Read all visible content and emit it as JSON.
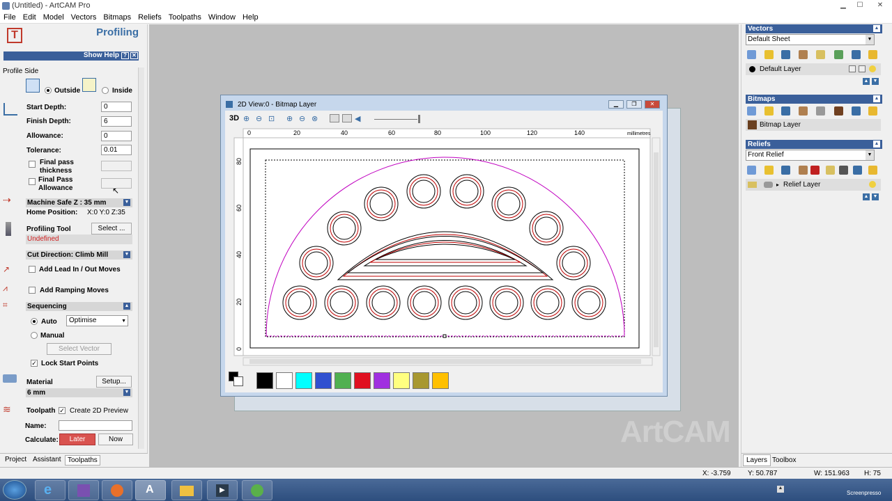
{
  "window": {
    "title": "(Untitled) - ArtCAM Pro"
  },
  "menu": [
    "File",
    "Edit",
    "Model",
    "Vectors",
    "Bitmaps",
    "Reliefs",
    "Toolpaths",
    "Window",
    "Help"
  ],
  "left_panel": {
    "title": "Profiling",
    "show_help": "Show Help",
    "help_q": "?",
    "profile_side": "Profile Side",
    "outside": "Outside",
    "inside": "Inside",
    "start_depth_label": "Start Depth:",
    "start_depth": "0",
    "finish_depth_label": "Finish Depth:",
    "finish_depth": "6",
    "allowance_label": "Allowance:",
    "allowance": "0",
    "tolerance_label": "Tolerance:",
    "tolerance": "0.01",
    "final_pass_thickness": "Final pass thickness",
    "final_pass_allowance": "Final Pass Allowance",
    "machine_safe_z": "Machine Safe Z : 35 mm",
    "home_position_label": "Home Position:",
    "home_position": "X:0 Y:0 Z:35",
    "profiling_tool": "Profiling Tool",
    "select_btn": "Select ...",
    "undefined": "Undefined",
    "cut_direction": "Cut Direction: Climb Mill",
    "add_lead": "Add Lead In / Out Moves",
    "add_ramping": "Add Ramping Moves",
    "sequencing": "Sequencing",
    "auto": "Auto",
    "optimise": "Optimise",
    "manual": "Manual",
    "select_vector": "Select Vector",
    "lock_start_points": "Lock Start Points",
    "material": "Material",
    "setup_btn": "Setup...",
    "material_value": "6 mm",
    "toolpath_label": "Toolpath",
    "create_2d_preview": "Create 2D Preview",
    "name_label": "Name:",
    "name_value": "",
    "calculate_label": "Calculate:",
    "later_btn": "Later",
    "now_btn": "Now",
    "tabs": [
      "Project",
      "Assistant",
      "Toolpaths"
    ]
  },
  "view": {
    "title": "2D View:0 - Bitmap Layer",
    "btn_3d": "3D",
    "ruler_x": [
      "0",
      "20",
      "40",
      "60",
      "80",
      "100",
      "120",
      "140"
    ],
    "ruler_unit": "millimetres",
    "ruler_y": [
      "80",
      "60",
      "40",
      "20",
      "0"
    ],
    "palette": [
      "#000000",
      "#ffffff",
      "#00ffff",
      "#3050d0",
      "#50b050",
      "#e01020",
      "#a030e0",
      "#ffff80",
      "#a89830",
      "#ffc000"
    ]
  },
  "watermark": "ArtCAM",
  "right_panel": {
    "vectors_title": "Vectors",
    "vectors_sheet": "Default Sheet",
    "default_layer": "Default Layer",
    "bitmaps_title": "Bitmaps",
    "bitmap_layer": "Bitmap Layer",
    "reliefs_title": "Reliefs",
    "reliefs_select": "Front Relief",
    "relief_layer": "Relief Layer",
    "tabs": [
      "Layers",
      "Toolbox"
    ]
  },
  "status": {
    "x": "X: -3.759",
    "y": "Y: 50.787",
    "w": "W: 151.963",
    "h": "H: 75"
  },
  "taskbar": {
    "tray_label": "Screenpresso"
  }
}
